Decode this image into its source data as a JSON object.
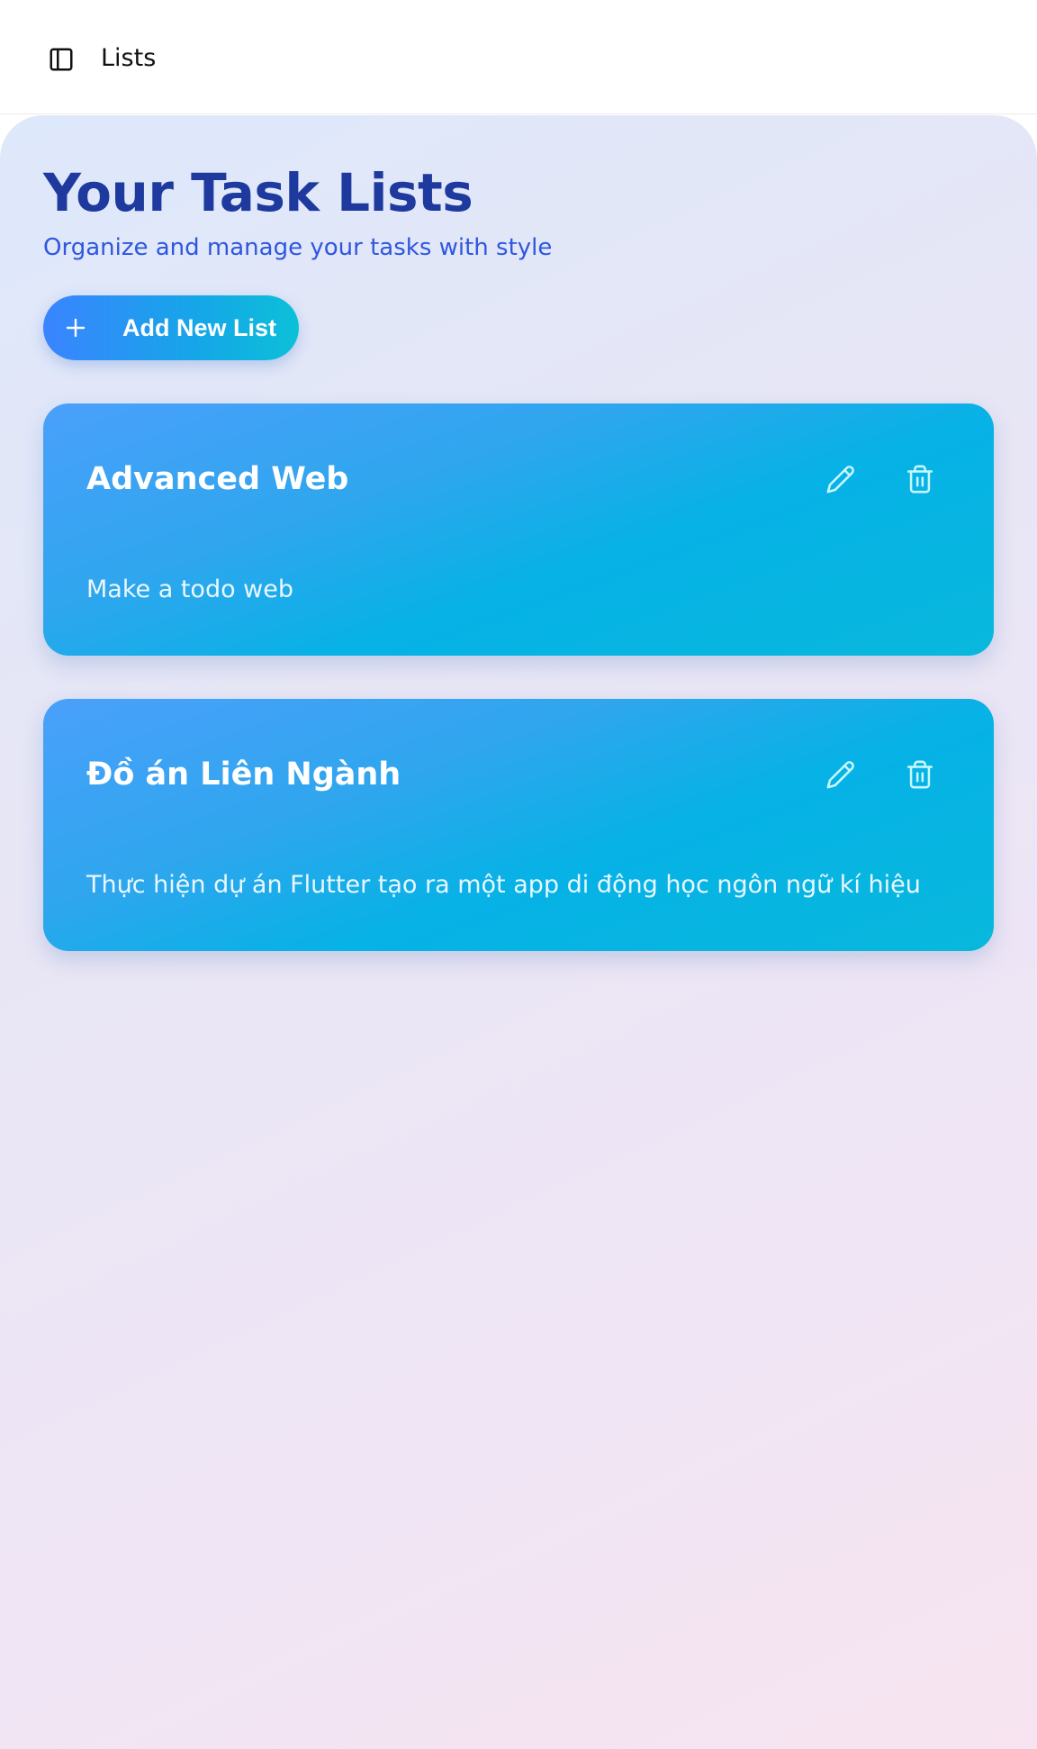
{
  "header": {
    "sidebar_icon": "sidebar-panel-icon",
    "title": "Lists"
  },
  "main": {
    "title": "Your Task Lists",
    "subtitle": "Organize and manage your tasks with style",
    "add_button": {
      "icon": "plus-icon",
      "label": "Add New List"
    },
    "lists": [
      {
        "title": "Advanced Web",
        "description": "Make a todo web",
        "edit_icon": "pencil-icon",
        "delete_icon": "trash-icon"
      },
      {
        "title": "Đồ án Liên Ngành",
        "description": "Thực hiện dự án Flutter tạo ra một app di động học ngôn ngữ kí hiệu",
        "edit_icon": "pencil-icon",
        "delete_icon": "trash-icon"
      }
    ]
  },
  "colors": {
    "title": "#1e3a9e",
    "subtitle": "#2f56e0",
    "card_start": "#4aa0fb",
    "card_end": "#08b8dc",
    "icon_tint": "#c8f7ff"
  }
}
